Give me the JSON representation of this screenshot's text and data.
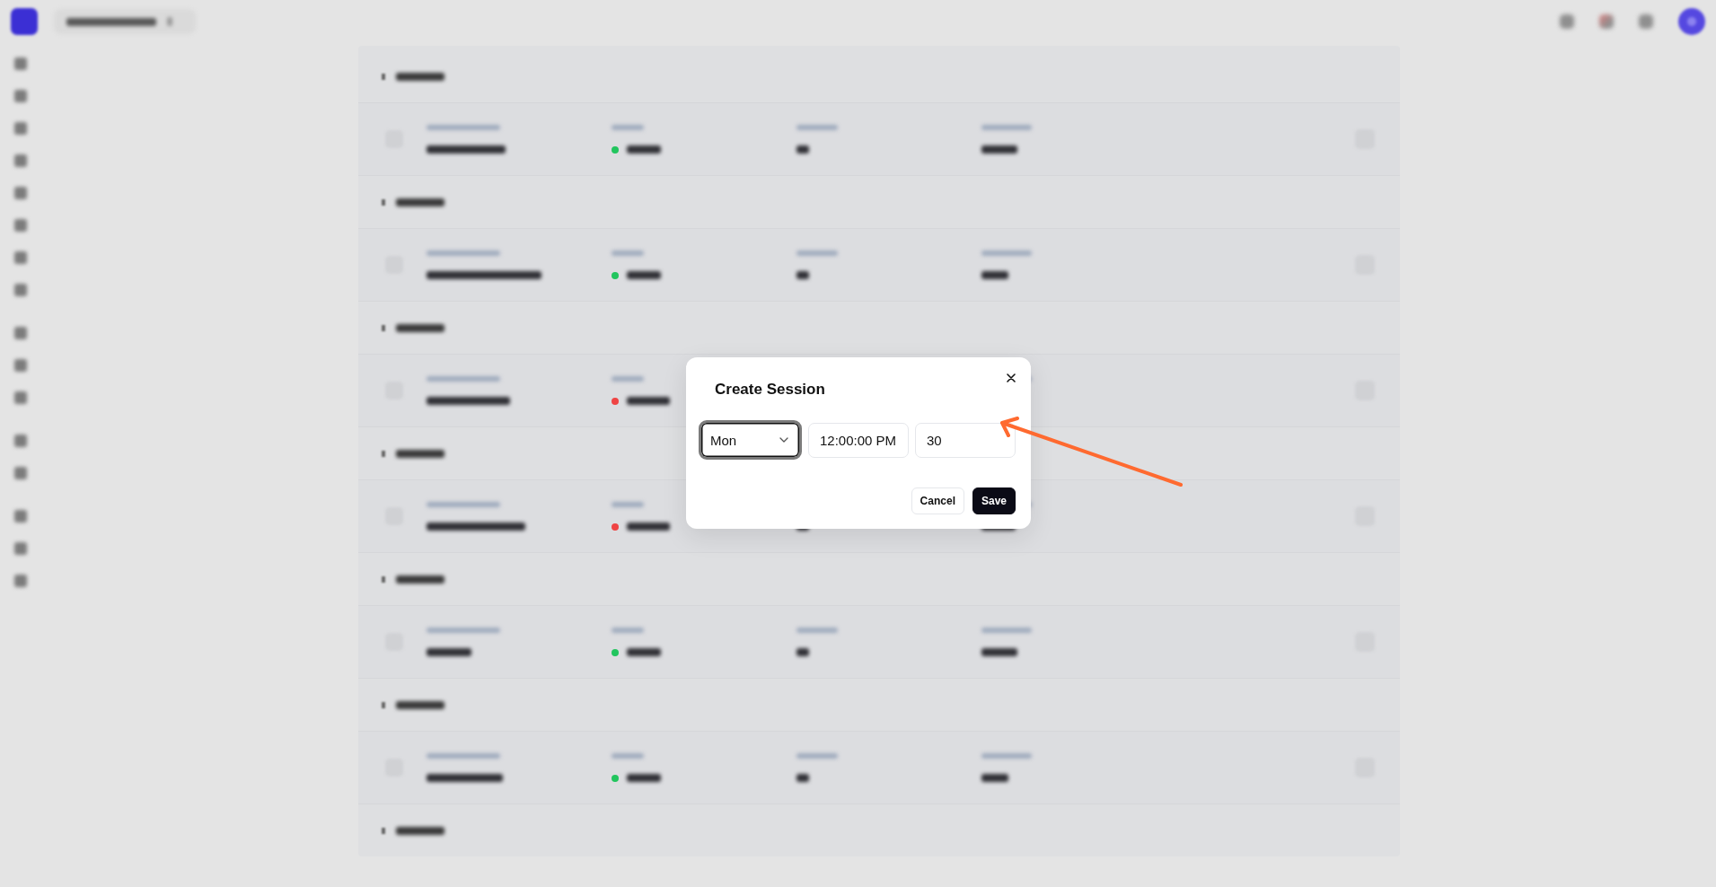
{
  "backdrop": {
    "rows": [
      {
        "color": "#22c55e"
      },
      {
        "color": "#22c55e"
      },
      {
        "color": "#ef4444"
      },
      {
        "color": "#ef4444"
      },
      {
        "color": "#22c55e"
      },
      {
        "color": "#22c55e"
      }
    ]
  },
  "dialog": {
    "title": "Create Session",
    "fields": [
      {
        "kind": "select",
        "value": "Mon",
        "focused": true
      },
      {
        "kind": "input",
        "value": "12:00:00 PM",
        "focused": false
      },
      {
        "kind": "input",
        "value": "30",
        "focused": false
      }
    ],
    "buttons": [
      {
        "label": "Cancel",
        "kind": "secondary"
      },
      {
        "label": "Save",
        "kind": "primary"
      }
    ]
  }
}
